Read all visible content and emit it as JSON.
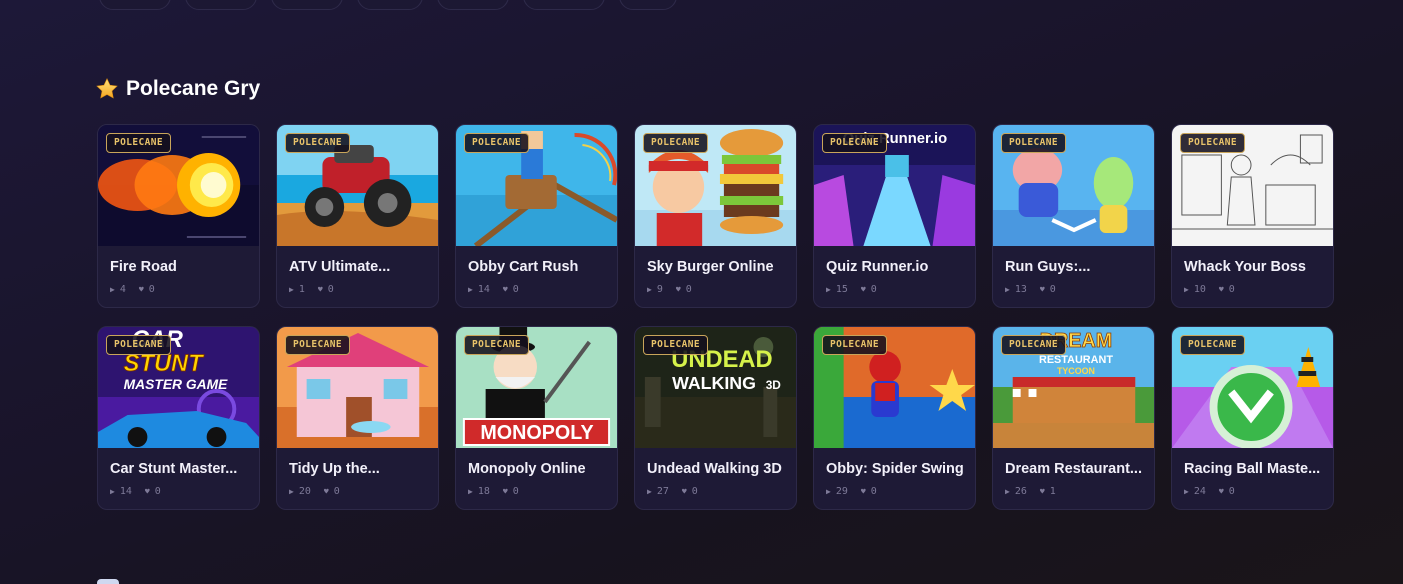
{
  "section": {
    "icon": "star-icon",
    "title": "Polecane Gry"
  },
  "badge_label": "POLECANE",
  "colors": {
    "badge_text": "#e8c36a",
    "badge_border": "#c9a55a",
    "card_bg": "#1e1a36"
  },
  "games": [
    {
      "title": "Fire Road",
      "plays": "4",
      "likes": "0",
      "art": "fire"
    },
    {
      "title": "ATV Ultimate...",
      "plays": "1",
      "likes": "0",
      "art": "atv"
    },
    {
      "title": "Obby Cart Rush",
      "plays": "14",
      "likes": "0",
      "art": "obby"
    },
    {
      "title": "Sky Burger Online",
      "plays": "9",
      "likes": "0",
      "art": "burger"
    },
    {
      "title": "Quiz Runner.io",
      "plays": "15",
      "likes": "0",
      "art": "quiz"
    },
    {
      "title": "Run Guys:...",
      "plays": "13",
      "likes": "0",
      "art": "runguys"
    },
    {
      "title": "Whack Your Boss",
      "plays": "10",
      "likes": "0",
      "art": "boss"
    },
    {
      "title": "Car Stunt Master...",
      "plays": "14",
      "likes": "0",
      "art": "carstunt"
    },
    {
      "title": "Tidy Up the...",
      "plays": "20",
      "likes": "0",
      "art": "tidy"
    },
    {
      "title": "Monopoly Online",
      "plays": "18",
      "likes": "0",
      "art": "monopoly"
    },
    {
      "title": "Undead Walking 3D",
      "plays": "27",
      "likes": "0",
      "art": "undead"
    },
    {
      "title": "Obby: Spider Swing",
      "plays": "29",
      "likes": "0",
      "art": "spider"
    },
    {
      "title": "Dream Restaurant...",
      "plays": "26",
      "likes": "1",
      "art": "dream"
    },
    {
      "title": "Racing Ball Maste...",
      "plays": "24",
      "likes": "0",
      "art": "ball"
    }
  ],
  "thumb_text": {
    "quiz": "Quiz Runner.io",
    "carstunt_1": "CAR",
    "carstunt_2": "STUNT",
    "carstunt_3": "MASTER GAME",
    "monopoly": "MONOPOLY",
    "undead_1": "UNDEAD",
    "undead_2": "WALKING",
    "undead_3": "3D",
    "dream_1": "DREAM",
    "dream_2": "RESTAURANT",
    "dream_3": "TYCOON"
  }
}
